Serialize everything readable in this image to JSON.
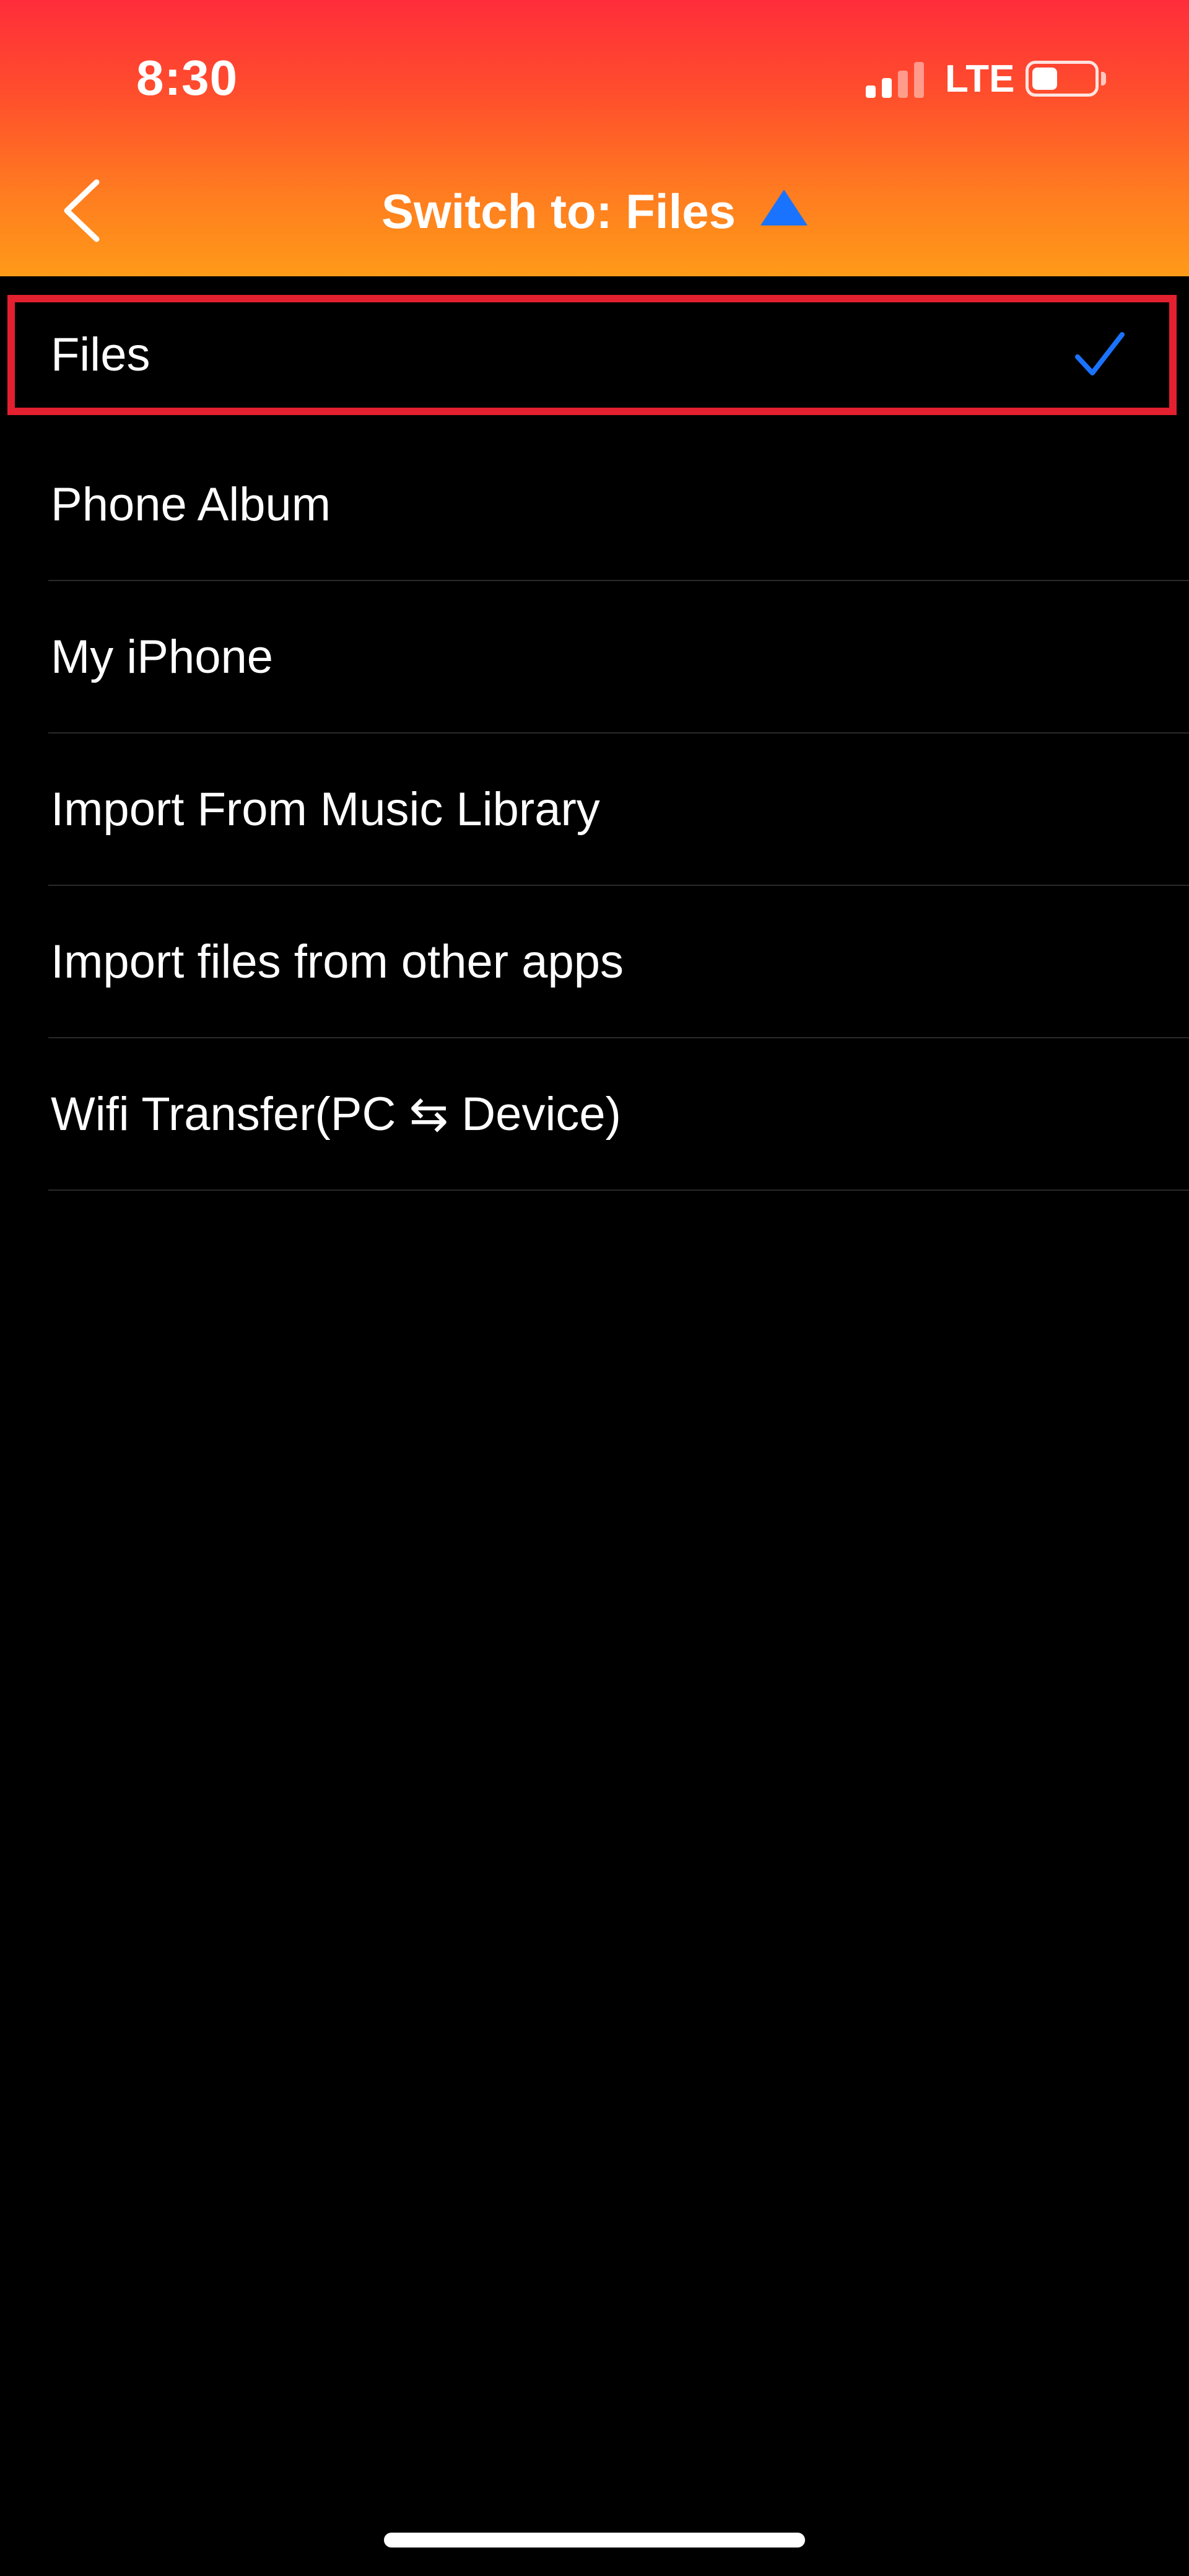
{
  "status_bar": {
    "time": "8:30",
    "network": "LTE",
    "signal_icon": "cellular-signal-icon",
    "battery_icon": "battery-icon",
    "battery_level": 0.25
  },
  "nav": {
    "back_icon": "chevron-left-icon",
    "title": "Switch to: Files",
    "caret_icon": "triangle-up-icon"
  },
  "colors": {
    "header_gradient_top": "#ff2d3a",
    "header_gradient_bottom": "#ff9a18",
    "accent_blue": "#1a73ff",
    "highlight_red": "#e3202f",
    "background": "#000000"
  },
  "menu": {
    "selected_index": 0,
    "items": [
      {
        "label": "Files",
        "selected": true,
        "icon": "checkmark-icon"
      },
      {
        "label": "Phone Album"
      },
      {
        "label": "My iPhone"
      },
      {
        "label": "Import From Music Library"
      },
      {
        "label": "Import files from other apps"
      },
      {
        "label": "Wifi Transfer(PC ⇆ Device)"
      }
    ]
  }
}
